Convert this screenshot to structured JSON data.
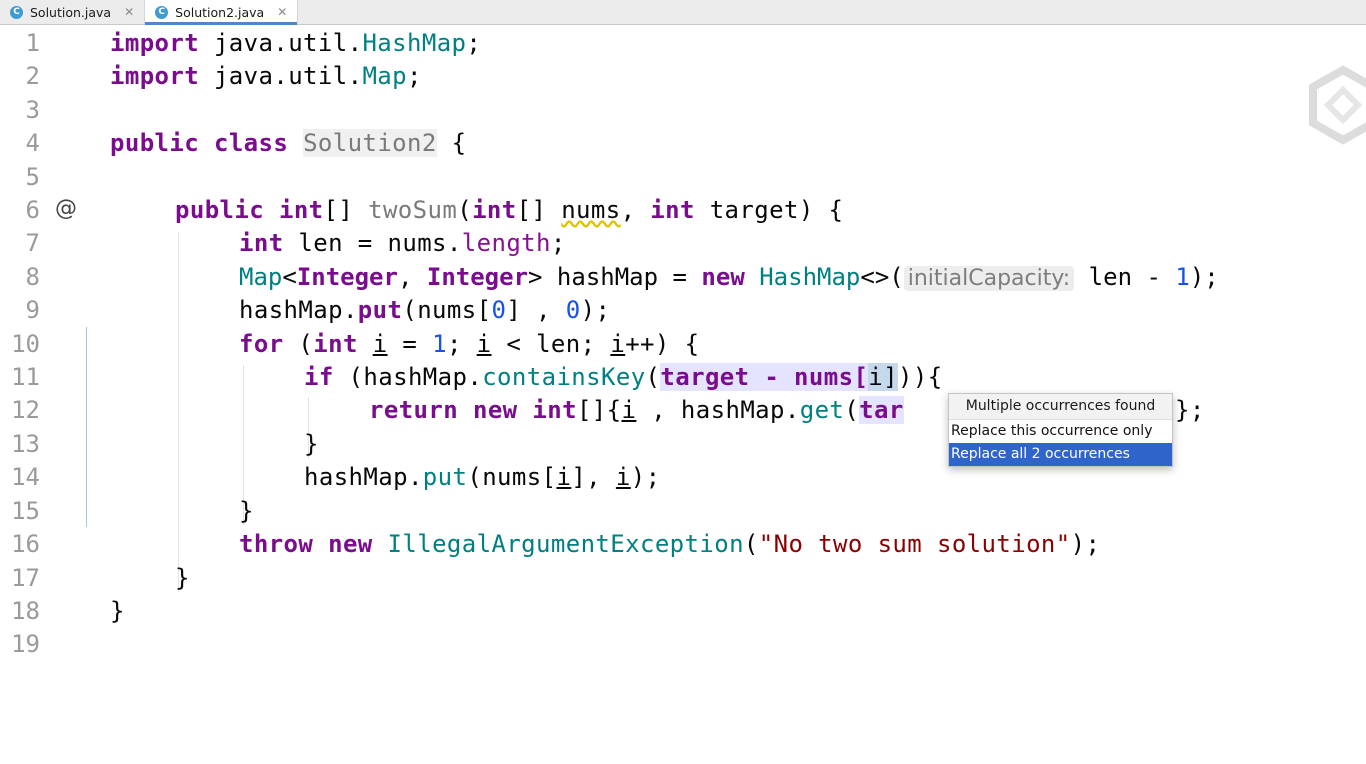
{
  "tabs": [
    {
      "label": "Solution.java",
      "icon": "C",
      "active": false
    },
    {
      "label": "Solution2.java",
      "icon": "C",
      "active": true
    }
  ],
  "gutter": {
    "line_numbers": [
      "1",
      "2",
      "3",
      "4",
      "5",
      "6",
      "7",
      "8",
      "9",
      "10",
      "11",
      "12",
      "13",
      "14",
      "15",
      "16",
      "17",
      "18",
      "19"
    ],
    "override_marker": "@"
  },
  "code": {
    "l1": {
      "kw": "import",
      "rest1": " java.util.",
      "cls": "HashMap",
      "end": ";"
    },
    "l2": {
      "kw": "import",
      "rest1": " java.util.",
      "cls": "Map",
      "end": ";"
    },
    "l4": {
      "kw1": "public",
      "kw2": "class",
      "name": "Solution2",
      "end": " {"
    },
    "l6": {
      "kw1": "public",
      "kw2": "int",
      "brk": "[] ",
      "mth": "twoSum",
      "p1": "(",
      "kw3": "int",
      "p2": "[] ",
      "arg1": "nums",
      "p3": ", ",
      "kw4": "int",
      "arg2": " target",
      "end": ") {"
    },
    "l7": {
      "kw": "int",
      "a": " len = nums.",
      "fld": "length",
      "end": ";"
    },
    "l8": {
      "cls1": "Map",
      "a": "<",
      "cls2": "Integer",
      "b": ", ",
      "cls3": "Integer",
      "c": "> hashMap = ",
      "kw": "new",
      "d": " ",
      "cls4": "HashMap",
      "e": "<>(",
      "hint": "initialCapacity:",
      "f": " len - ",
      "num": "1",
      "end": ");"
    },
    "l9": {
      "a": "hashMap.",
      "mth": "put",
      "b": "(nums[",
      "num1": "0",
      "c": "] , ",
      "num2": "0",
      "end": ");"
    },
    "l10": {
      "kw1": "for",
      "a": " (",
      "kw2": "int",
      "b": " ",
      "i1": "i",
      "c": " = ",
      "num": "1",
      "d": "; ",
      "i2": "i",
      "e": " < len; ",
      "i3": "i",
      "end": "++) {"
    },
    "l11": {
      "kw": "if",
      "a": " (hashMap.",
      "mth": "containsKey",
      "b": "(",
      "sel1": "target - nums[",
      "caret": "i]",
      "end": ")){"
    },
    "l12": {
      "kw1": "return",
      "a": " ",
      "kw2": "new",
      "b": " ",
      "kw3": "int",
      "c": "[]{",
      "i1": "i",
      "d": " , hashMap.",
      "mth": "get",
      "e": "(",
      "sel": "tar",
      "end": "};"
    },
    "l13": {
      "a": "}"
    },
    "l14": {
      "a": "hashMap.",
      "mth": "put",
      "b": "(nums[",
      "i1": "i",
      "c": "], ",
      "i2": "i",
      "end": ");"
    },
    "l15": {
      "a": "}"
    },
    "l16": {
      "kw1": "throw",
      "a": " ",
      "kw2": "new",
      "b": " ",
      "cls": "IllegalArgumentException",
      "c": "(",
      "str": "\"No two sum solution\"",
      "end": ");"
    },
    "l17": {
      "a": "}"
    },
    "l18": {
      "a": "}"
    }
  },
  "popup": {
    "title": "Multiple occurrences found",
    "items": [
      "Replace this occurrence only",
      "Replace all 2 occurrences"
    ],
    "selected_index": 1
  },
  "colors": {
    "keyword": "#7a0c8e",
    "class": "#008080",
    "number": "#1750eb",
    "string": "#8b0000",
    "popup_selected": "#2f65ca"
  }
}
